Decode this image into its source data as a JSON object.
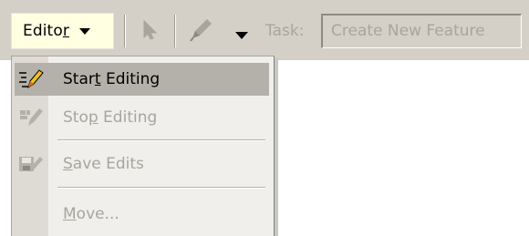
{
  "toolbar": {
    "editor_label": "Editor",
    "editor_underline_index": 5,
    "task_label": "Task:",
    "task_value": "Create New Feature",
    "edit_tool_icon": "arrow-pointer-icon",
    "sketch_tool_icon": "pencil-icon"
  },
  "menu": {
    "items": [
      {
        "label": "Start Editing",
        "underline": "t",
        "underline_index": 4,
        "enabled": true,
        "highlighted": true,
        "icon": "start-editing-icon"
      },
      {
        "label": "Stop Editing",
        "underline": "p",
        "underline_index": 3,
        "enabled": false,
        "highlighted": false,
        "icon": "stop-editing-icon"
      },
      {
        "label": "Save Edits",
        "underline": "S",
        "underline_index": 0,
        "enabled": false,
        "highlighted": false,
        "icon": "save-edits-icon"
      },
      {
        "label": "Move...",
        "underline": "M",
        "underline_index": 0,
        "enabled": false,
        "highlighted": false,
        "icon": ""
      }
    ]
  },
  "colors": {
    "toolbar_bg": "#d4d0c8",
    "editor_button_bg": "#ffffe1",
    "menu_bg": "#f0efeb",
    "menu_gutter": "#dedbd4",
    "highlight": "#b4b1aa",
    "disabled_text": "#a8a59e"
  }
}
